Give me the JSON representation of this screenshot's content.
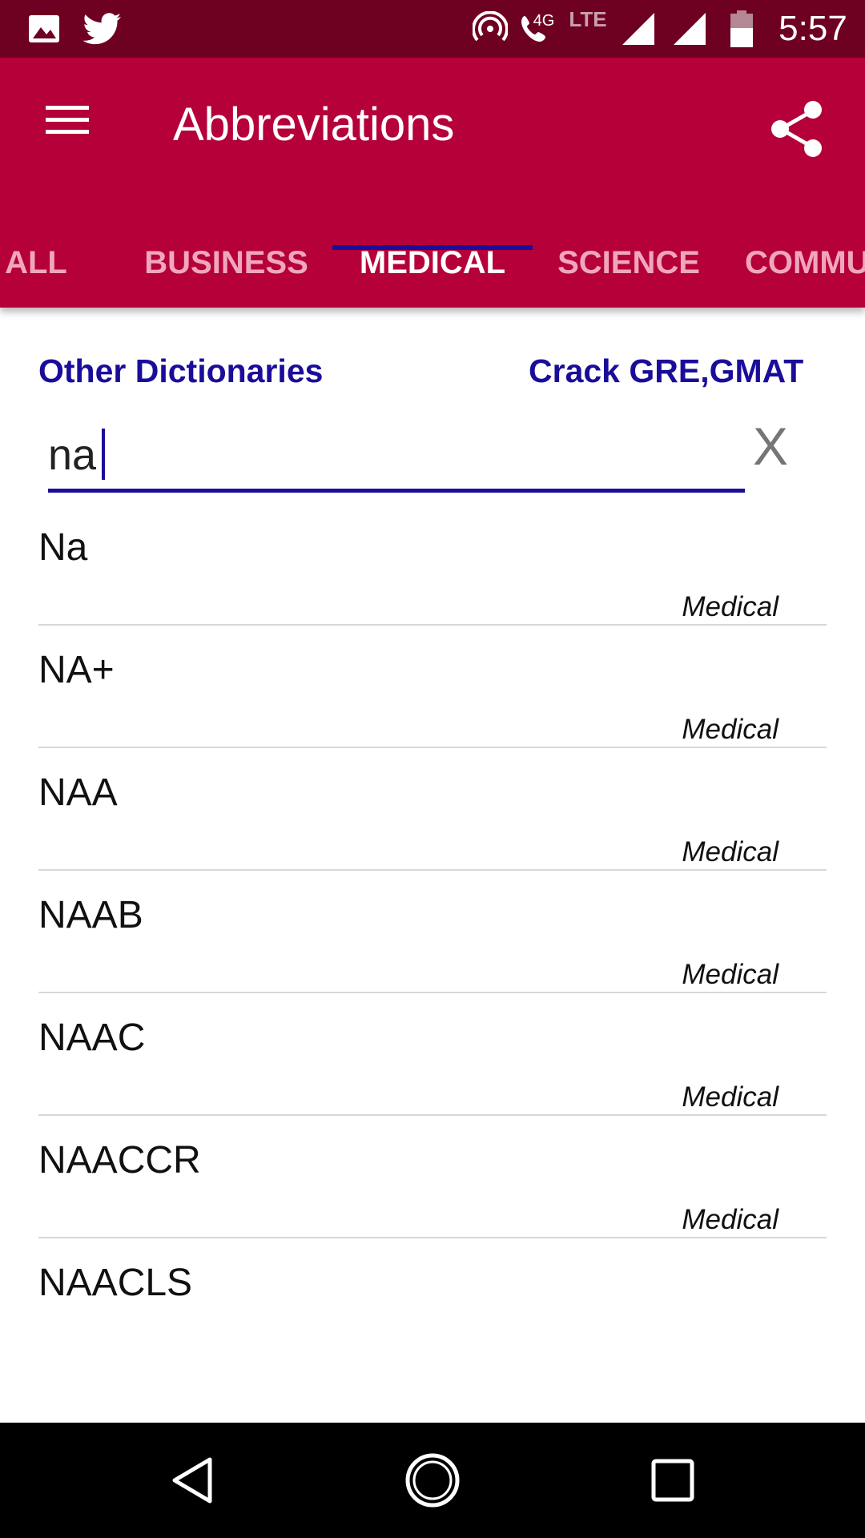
{
  "status_bar": {
    "time": "5:57",
    "network_4g": "4G",
    "network_lte": "LTE",
    "icons": [
      "image-icon",
      "twitter-icon",
      "hotspot-icon",
      "wifi-calling-icon",
      "signal-icon",
      "signal-icon",
      "battery-icon"
    ]
  },
  "app_bar": {
    "title": "Abbreviations",
    "menu_icon": "menu-icon",
    "share_icon": "share-icon",
    "background": "#b5003a"
  },
  "tabs": [
    {
      "label": "ALL",
      "active": false
    },
    {
      "label": "BUSINESS",
      "active": false
    },
    {
      "label": "MEDICAL",
      "active": true
    },
    {
      "label": "SCIENCE",
      "active": false
    },
    {
      "label": "COMMU",
      "active": false
    }
  ],
  "links": {
    "other_dictionaries": "Other Dictionaries",
    "crack_gre": "Crack GRE,GMAT"
  },
  "search": {
    "value": "na",
    "clear_label": "X"
  },
  "results": [
    {
      "term": "Na",
      "category": "Medical"
    },
    {
      "term": "NA+",
      "category": "Medical"
    },
    {
      "term": "NAA",
      "category": "Medical"
    },
    {
      "term": "NAAB",
      "category": "Medical"
    },
    {
      "term": "NAAC",
      "category": "Medical"
    },
    {
      "term": "NAACCR",
      "category": "Medical"
    },
    {
      "term": "NAACLS",
      "category": ""
    }
  ],
  "colors": {
    "accent": "#1a0d99",
    "status_bar": "#6e0022",
    "inactive_tab": "#f0a7bd"
  },
  "nav_bar": {
    "icons": [
      "back-icon",
      "home-icon",
      "recents-icon"
    ]
  }
}
